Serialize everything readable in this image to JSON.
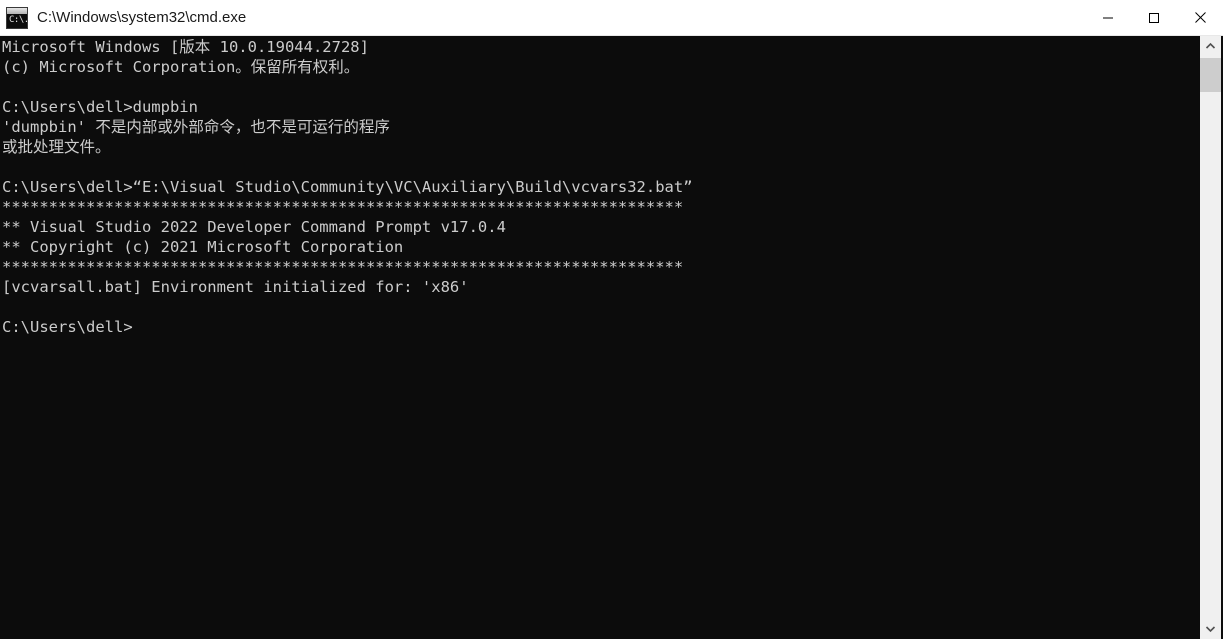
{
  "window": {
    "title": "C:\\Windows\\system32\\cmd.exe",
    "icon_name": "cmd-icon",
    "icon_glyph": "C:\\.",
    "background_color": "#0c0c0c",
    "text_color": "#cccccc",
    "titlebar_color": "#ffffff"
  },
  "title_buttons": {
    "minimize_label": "Minimize",
    "maximize_label": "Maximize",
    "close_label": "Close"
  },
  "scrollbar": {
    "up_arrow_label": "Scroll up",
    "down_arrow_label": "Scroll down",
    "thumb_label": "Scroll thumb",
    "track_color": "#f0f0f0",
    "thumb_color": "#cdcdcd"
  },
  "console": {
    "lines": [
      "Microsoft Windows [版本 10.0.19044.2728]",
      "(c) Microsoft Corporation。保留所有权利。",
      "",
      "C:\\Users\\dell>dumpbin",
      "'dumpbin' 不是内部或外部命令，也不是可运行的程序",
      "或批处理文件。",
      "",
      "C:\\Users\\dell>“E:\\Visual Studio\\Community\\VC\\Auxiliary\\Build\\vcvars32.bat”",
      "*************************************************************************",
      "** Visual Studio 2022 Developer Command Prompt v17.0.4",
      "** Copyright (c) 2021 Microsoft Corporation",
      "*************************************************************************",
      "[vcvarsall.bat] Environment initialized for: 'x86'",
      "",
      "C:\\Users\\dell>"
    ],
    "text": "Microsoft Windows [版本 10.0.19044.2728]\n(c) Microsoft Corporation。保留所有权利。\n\nC:\\Users\\dell>dumpbin\n'dumpbin' 不是内部或外部命令，也不是可运行的程序\n或批处理文件。\n\nC:\\Users\\dell>“E:\\Visual Studio\\Community\\VC\\Auxiliary\\Build\\vcvars32.bat”\n*************************************************************************\n** Visual Studio 2022 Developer Command Prompt v17.0.4\n** Copyright (c) 2021 Microsoft Corporation\n*************************************************************************\n[vcvarsall.bat] Environment initialized for: 'x86'\n\nC:\\Users\\dell>"
  }
}
